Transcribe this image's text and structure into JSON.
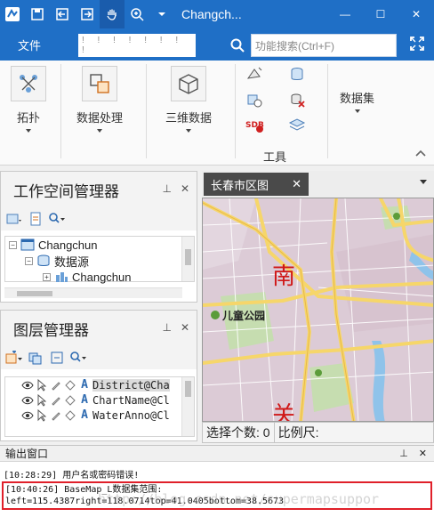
{
  "window": {
    "title": "Changch...",
    "minimize_glyph": "—",
    "maximize_glyph": "☐",
    "close_glyph": "✕"
  },
  "quick_access": [
    "app-logo-icon",
    "save-icon",
    "import-icon",
    "export-icon",
    "pan-hand-icon",
    "zoom-in-icon",
    "dropdown-arrow-icon"
  ],
  "menubar": {
    "file_label": "文件",
    "tabs_placeholder": "! ! ! ! ! ! ! !",
    "search_placeholder": "功能搜索(Ctrl+F)"
  },
  "ribbon": {
    "groups": [
      {
        "label": "拓扑",
        "icon": "topology-icon"
      },
      {
        "label": "数据处理",
        "icon": "data-processing-icon"
      },
      {
        "label": "三维数据",
        "icon": "3d-data-icon"
      },
      {
        "label": "数据集",
        "icon": "dataset-icon"
      }
    ],
    "tools_label": "工具"
  },
  "workspace_panel": {
    "title": "工作空间管理器",
    "pin_glyph": "📌",
    "close_glyph": "✕",
    "tree": [
      {
        "label": "Changchun",
        "level": 0,
        "expander": "−"
      },
      {
        "label": "数据源",
        "level": 1,
        "expander": "−"
      },
      {
        "label": "Changchun",
        "level": 2,
        "expander": "+"
      }
    ]
  },
  "layer_panel": {
    "title": "图层管理器",
    "pin_glyph": "📌",
    "close_glyph": "✕",
    "layers": [
      {
        "label": "District@Cha",
        "selected": true
      },
      {
        "label": "ChartName@Cl",
        "selected": false
      },
      {
        "label": "WaterAnno@Cl",
        "selected": false
      }
    ]
  },
  "map_view": {
    "tab_label": "长春市区图",
    "close_glyph": "✕",
    "labels": {
      "district_large": "南",
      "park": "儿童公园",
      "district_bottom": "关"
    }
  },
  "statusbar": {
    "selected_count": "选择个数: 0",
    "scale_label": "比例尺:"
  },
  "output": {
    "title": "输出窗口",
    "lines": [
      "[10:28:29] 用户名或密码错误!",
      "[10:40:26] BaseMap_L数据集范围: left=115.4387right=118.0714top=41.0405bottom=38.5673"
    ]
  },
  "watermark": "http://blog.csdn.net/supermapsuppor",
  "colors": {
    "title_blue": "#1f6fc6",
    "highlight_red": "#e0202a",
    "map_base": "#d9c6d0",
    "road_yellow": "#f6d66a",
    "water_blue": "#8fc3ea",
    "park_green": "#c6ddb0",
    "district_red": "#d01818"
  }
}
